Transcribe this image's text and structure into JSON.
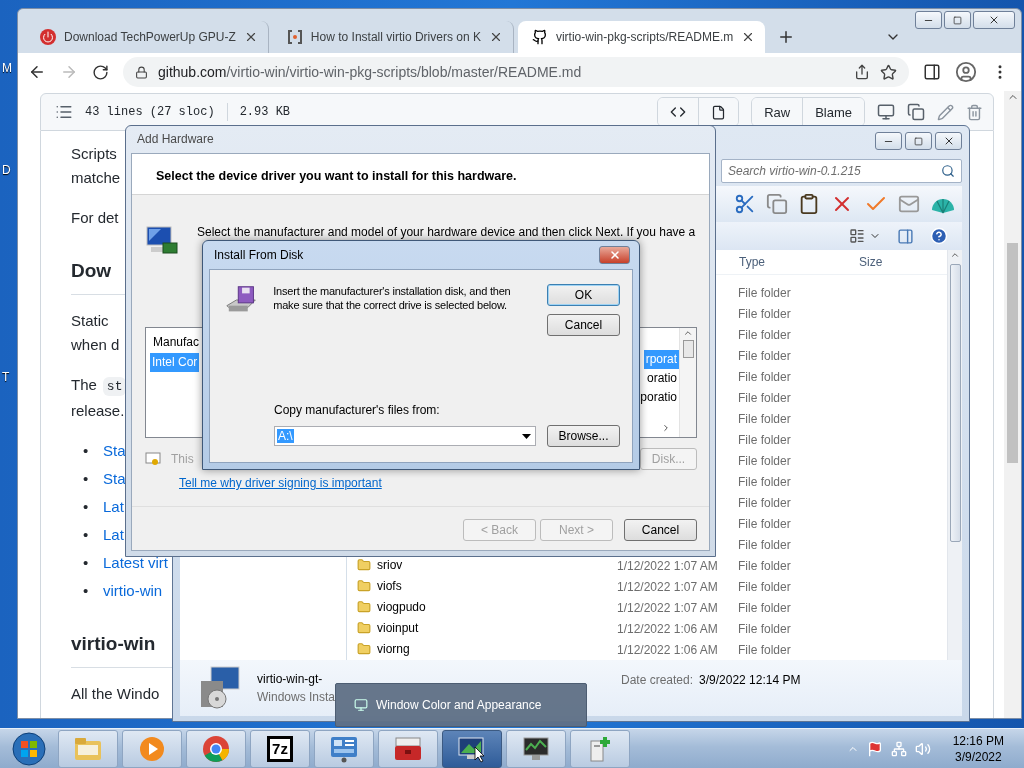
{
  "desktop": {
    "icon_labels": [
      "M",
      "D",
      "T"
    ]
  },
  "browser": {
    "tabs": [
      {
        "kind": "power",
        "title": "Download TechPowerUp GPU-Z",
        "selected": false
      },
      {
        "kind": "site",
        "title": "How to Install virtio Drivers on K",
        "selected": false
      },
      {
        "kind": "github",
        "title": "virtio-win-pkg-scripts/README.m",
        "selected": true
      }
    ],
    "address": {
      "host": "github.com",
      "path": "/virtio-win/virtio-win-pkg-scripts/blob/master/README.md"
    },
    "forward_disabled": true,
    "file_info": {
      "lines": "43 lines (27 sloc)",
      "size": "2.93 KB"
    },
    "file_actions": [
      "Raw",
      "Blame"
    ],
    "content": [
      {
        "kind": "paragraph",
        "lines": [
          {
            "text": "Scripts"
          },
          {
            "text": "matche"
          }
        ]
      },
      {
        "kind": "paragraph",
        "lines": [
          {
            "text": "For det"
          }
        ]
      },
      {
        "kind": "heading",
        "text": "Dow"
      },
      {
        "kind": "paragraph",
        "lines": [
          {
            "text": "Static"
          },
          {
            "text": "when d"
          }
        ]
      },
      {
        "kind": "paragraph",
        "lines": [
          {
            "text": "The",
            "code": "st"
          },
          {
            "text": "release."
          }
        ]
      },
      {
        "kind": "list",
        "marker": "•",
        "items": [
          "Sta",
          "Sta",
          "Lat",
          "Lat",
          "Latest virt",
          "virtio-win"
        ]
      },
      {
        "kind": "heading",
        "text": "virtio-win"
      },
      {
        "kind": "paragraph",
        "lines": [
          {
            "text": "All the Windo"
          }
        ]
      }
    ]
  },
  "explorer": {
    "search_placeholder": "Search virtio-win-0.1.215",
    "columns": [
      "Type",
      "Size"
    ],
    "rows": [
      {
        "type": "File folder"
      },
      {
        "type": "File folder"
      },
      {
        "type": "File folder"
      },
      {
        "type": "File folder"
      },
      {
        "type": "File folder"
      },
      {
        "type": "File folder"
      },
      {
        "type": "File folder"
      },
      {
        "type": "File folder"
      },
      {
        "type": "File folder"
      },
      {
        "type": "File folder"
      },
      {
        "type": "File folder"
      },
      {
        "type": "File folder"
      },
      {
        "type": "File folder"
      },
      {
        "name": "sriov",
        "date": "1/12/2022 1:07 AM",
        "type": "File folder"
      },
      {
        "name": "viofs",
        "date": "1/12/2022 1:07 AM",
        "type": "File folder"
      },
      {
        "name": "viogpudo",
        "date": "1/12/2022 1:07 AM",
        "type": "File folder"
      },
      {
        "name": "vioinput",
        "date": "1/12/2022 1:06 AM",
        "type": "File folder"
      },
      {
        "name": "viorng",
        "date": "1/12/2022 1:06 AM",
        "type": "File folder"
      }
    ],
    "details": {
      "name": "virtio-win-gt-",
      "file_type": "Windows Insta",
      "created_label": "Date created:",
      "created": "3/9/2022 12:14 PM"
    }
  },
  "add_hardware": {
    "title": "Add Hardware",
    "heading": "Select the device driver you want to install for this hardware.",
    "description": [
      "Select the manufacturer and model of your hardware device and then click Next. If you have a"
    ],
    "manufacturer_header": "Manufac",
    "manufacturers": [
      {
        "name": "Intel Cor",
        "selected": true
      }
    ],
    "models": [
      {
        "name": "rporat",
        "selected": true
      },
      {
        "name": "oratio",
        "selected": false
      },
      {
        "name": "poratio",
        "selected": false
      }
    ],
    "signing_text": "This",
    "have_disk": "Disk...",
    "link": "Tell me why driver signing is important",
    "buttons": [
      {
        "label": "< Back",
        "disabled": true
      },
      {
        "label": "Next >",
        "disabled": true
      },
      {
        "label": "Cancel",
        "disabled": false
      }
    ]
  },
  "install_from_disk": {
    "title": "Install From Disk",
    "message": "Insert the manufacturer's installation disk, and then make sure that the correct drive is selected below.",
    "ok": "OK",
    "cancel": "Cancel",
    "copy_label": "Copy manufacturer's files from:",
    "path": "A:\\",
    "path_selected": true,
    "browse": "Browse..."
  },
  "taskbar": {
    "tooltip": "Window Color and Appearance",
    "items": [
      {
        "kind": "folder",
        "selected": false
      },
      {
        "kind": "media",
        "selected": false
      },
      {
        "kind": "chrome",
        "selected": false
      },
      {
        "kind": "archive",
        "glyph": "7z",
        "selected": false
      },
      {
        "kind": "control-panel",
        "selected": false
      },
      {
        "kind": "toolbox",
        "selected": false
      },
      {
        "kind": "display",
        "selected": true
      },
      {
        "kind": "monitor",
        "selected": false
      },
      {
        "kind": "add-device",
        "selected": false
      }
    ],
    "time": "12:16 PM",
    "date": "3/9/2022"
  }
}
